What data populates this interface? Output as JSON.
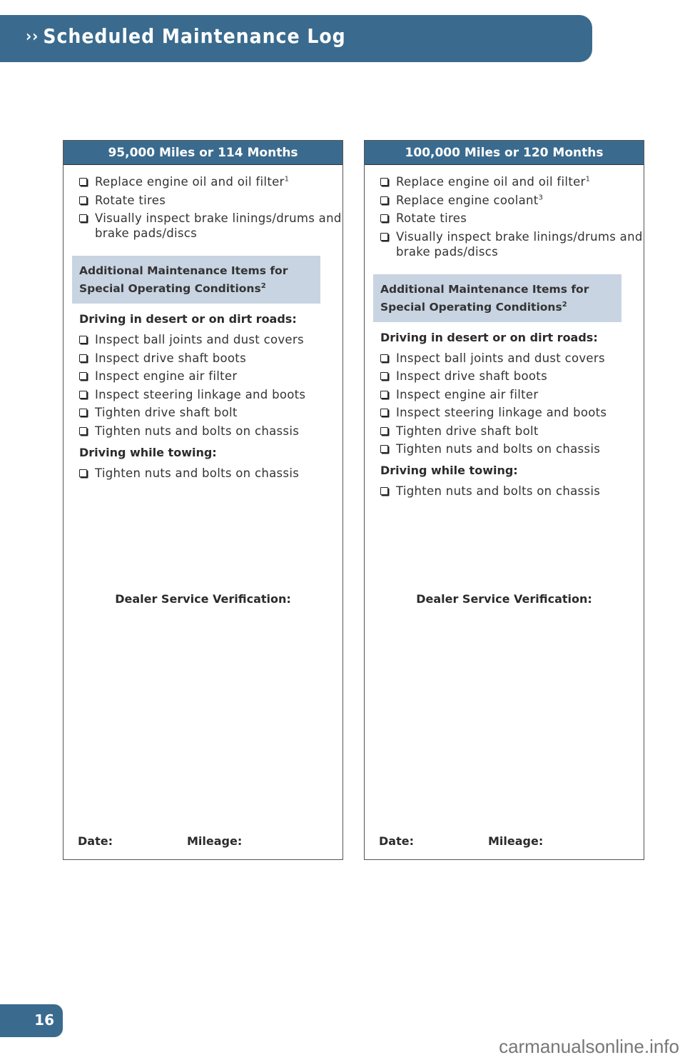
{
  "header": {
    "chevron_icon": "double-chevron-right",
    "title": "Scheduled Maintenance Log"
  },
  "cards": [
    {
      "heading": "95,000 Miles or 114 Months",
      "items": [
        {
          "text": "Replace engine oil and oil filter",
          "sup": "1"
        },
        {
          "text": "Rotate tires",
          "sup": ""
        },
        {
          "text": "Visually inspect brake linings/drums and brake pads/discs",
          "sup": ""
        }
      ],
      "additional_line1": "Additional Maintenance Items for",
      "additional_line2": "Special Operating Conditions",
      "additional_sup": "2",
      "desert_heading": "Driving in desert or on dirt roads:",
      "desert_items": [
        "Inspect ball joints and dust covers",
        "Inspect drive shaft boots",
        "Inspect engine air filter",
        "Inspect steering linkage and boots",
        "Tighten drive shaft bolt",
        "Tighten nuts and bolts on chassis"
      ],
      "towing_heading": "Driving while towing:",
      "towing_items": [
        "Tighten nuts and bolts on chassis"
      ],
      "dealer_label": "Dealer Service Verification:",
      "date_label": "Date:",
      "mileage_label": "Mileage:"
    },
    {
      "heading": "100,000 Miles or 120 Months",
      "items": [
        {
          "text": "Replace engine oil and oil filter",
          "sup": "1"
        },
        {
          "text": "Replace engine coolant",
          "sup": "3"
        },
        {
          "text": "Rotate tires",
          "sup": ""
        },
        {
          "text": "Visually inspect brake linings/drums and brake pads/discs",
          "sup": ""
        }
      ],
      "additional_line1": "Additional Maintenance Items for",
      "additional_line2": "Special Operating Conditions",
      "additional_sup": "2",
      "desert_heading": "Driving in desert or on dirt roads:",
      "desert_items": [
        "Inspect ball joints and dust covers",
        "Inspect drive shaft boots",
        "Inspect engine air filter",
        "Inspect steering linkage and boots",
        "Tighten drive shaft bolt",
        "Tighten nuts and bolts on chassis"
      ],
      "towing_heading": "Driving while towing:",
      "towing_items": [
        "Tighten nuts and bolts on chassis"
      ],
      "dealer_label": "Dealer Service Verification:",
      "date_label": "Date:",
      "mileage_label": "Mileage:"
    }
  ],
  "footer": {
    "page_number": "16",
    "watermark": "carmanualsonline.info"
  },
  "colors": {
    "brand_blue": "#3a6b8e",
    "additional_box_bg": "#c8d4e2"
  }
}
